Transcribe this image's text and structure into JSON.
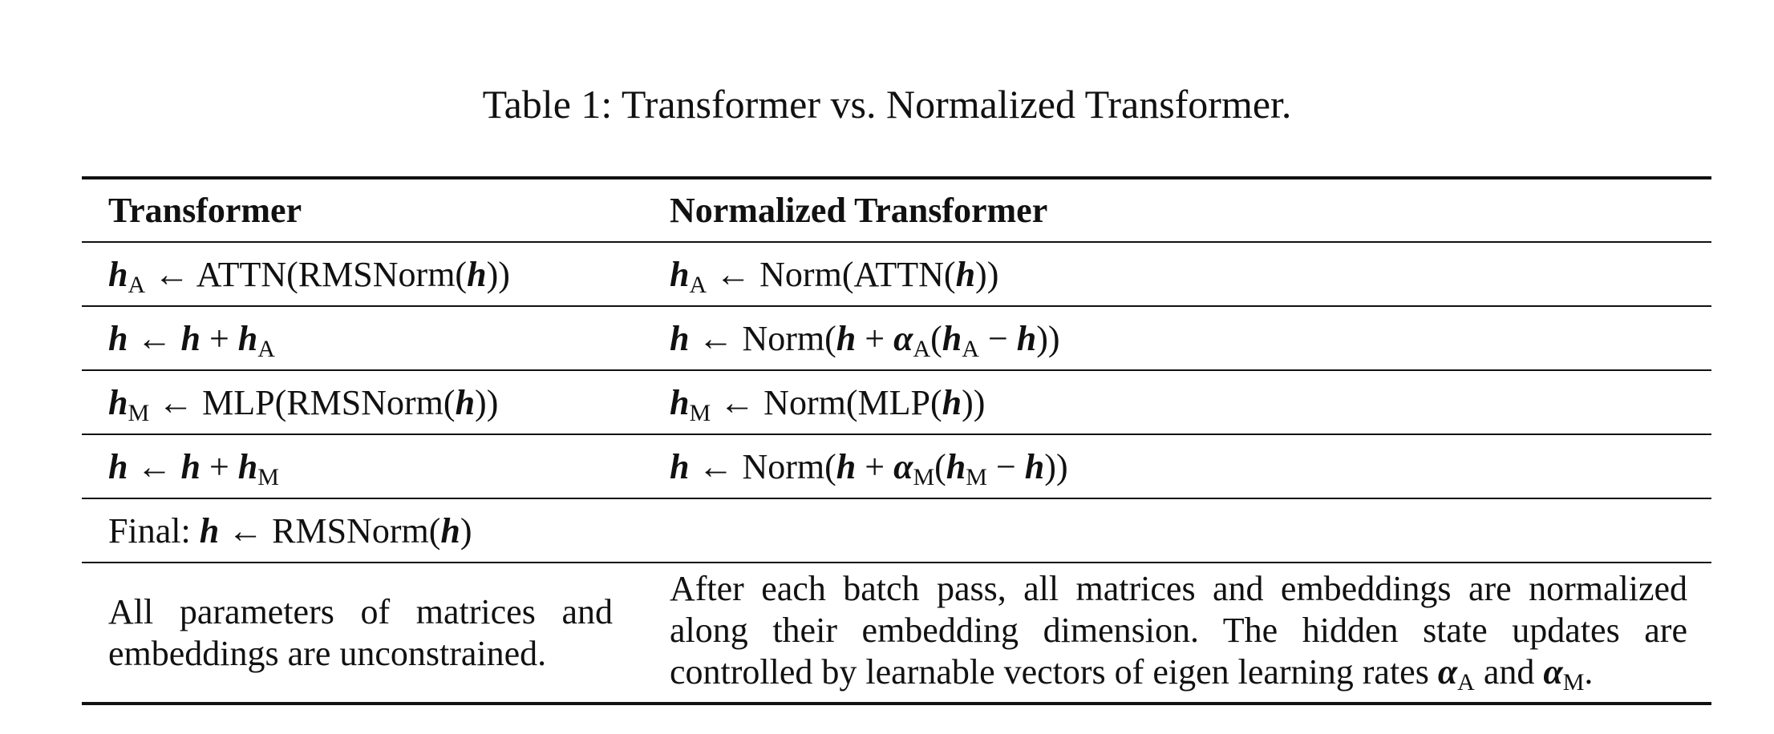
{
  "caption": "Table 1: Transformer vs. Normalized Transformer.",
  "headers": {
    "transformer": "Transformer",
    "normalized": "Normalized Transformer"
  },
  "symbols": {
    "h": "h",
    "alpha": "α",
    "arrow": "←",
    "plus": "+",
    "minus": "−",
    "lparen": "(",
    "rparen": ")",
    "A": "A",
    "M": "M"
  },
  "ops": {
    "attn": "ATTN",
    "mlp": "MLP",
    "rmsnorm": "RMSNorm",
    "norm": "Norm",
    "final_label": "Final:"
  },
  "text": {
    "left_desc": "All parameters of matrices and embeddings are unconstrained.",
    "right_desc_main": "After each batch pass, all matrices and embeddings are normalized along their embedding dimension. The hidden state updates are controlled by learnable vectors of eigen learning rates",
    "and": "and",
    "period": "."
  }
}
